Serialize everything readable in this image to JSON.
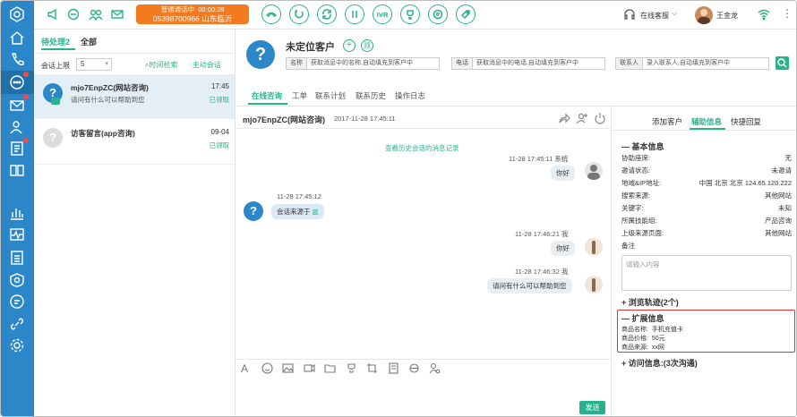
{
  "topbar": {
    "call_status": "普通通话中",
    "call_timer": "00:00:28",
    "phone": "05398700966",
    "location": "山东临沂",
    "ivr_label": "IVR",
    "agent_status": "在线客服",
    "user_name": "王金龙"
  },
  "list": {
    "tab_pending": "待处理2",
    "tab_all": "全部",
    "limit_label": "会话上限",
    "limit_value": "5",
    "time_search": "时间检索",
    "proactive": "主动会话",
    "items": [
      {
        "name": "mjo7EnpZC(网站咨询)",
        "time": "17:45",
        "preview": "请问有什么可以帮助到您",
        "status": "已领取"
      },
      {
        "name": "访客留言(app咨询)",
        "time": "09-04",
        "preview": "",
        "status": "已领取"
      }
    ]
  },
  "customer": {
    "name": "未定位客户",
    "name_label": "名称",
    "name_placeholder": "获取消息中的名称,自动填充到客户中",
    "phone_label": "电话",
    "phone_placeholder": "获取消息中的电话,自动填充到客户中",
    "contact_label": "联系人",
    "contact_placeholder": "录入联系人,自动填充到客户中",
    "tabs": [
      "在线咨询",
      "工单",
      "联系计划",
      "联系历史",
      "操作日志"
    ]
  },
  "chat": {
    "title": "mjo7EnpZC(网站咨询)",
    "date": "2017-11-28 17:45:11",
    "history_link": "查看历史会话的消息记录",
    "messages": [
      {
        "side": "right",
        "time": "11-28 17:45:11 系统",
        "text": "你好"
      },
      {
        "side": "left",
        "time": "11-28 17:45:12",
        "text": "会话来源于"
      },
      {
        "side": "right",
        "time": "11-28 17:46:21 我",
        "text": "你好"
      },
      {
        "side": "right",
        "time": "11-28 17:46:32 我",
        "text": "请问有什么可以帮助到您"
      }
    ],
    "send": "发送"
  },
  "info": {
    "tabs": [
      "添加客户",
      "辅助信息",
      "快捷回复"
    ],
    "basic_title": "基本信息",
    "basic_rows": [
      {
        "label": "协助座席:",
        "value": "无"
      },
      {
        "label": "邀请状态:",
        "value": "未邀请"
      },
      {
        "label": "地域&IP地址:",
        "value": "中国 北京 北京 124.65.120.222"
      },
      {
        "label": "搜索来源:",
        "value": "其他网站"
      },
      {
        "label": "关键字:",
        "value": "未知"
      },
      {
        "label": "所属技能组:",
        "value": "产品咨询"
      },
      {
        "label": "上级来源页面:",
        "value": "其他网站"
      },
      {
        "label": "备注",
        "value": ""
      }
    ],
    "note_placeholder": "请输入内容",
    "browse_title": "浏览轨迹(2个)",
    "ext_title": "扩展信息",
    "ext_rows": [
      {
        "label": "商品名称:",
        "value": "手机充值卡"
      },
      {
        "label": "商品价格:",
        "value": "50元"
      },
      {
        "label": "商品来源:",
        "value": "xx网"
      }
    ],
    "visit_title": "访问信息:(3次沟通)"
  },
  "colors": {
    "accent": "#29b28a",
    "nav": "#2b87c8",
    "call": "#f47a1f",
    "highlight": "#e0303a"
  }
}
